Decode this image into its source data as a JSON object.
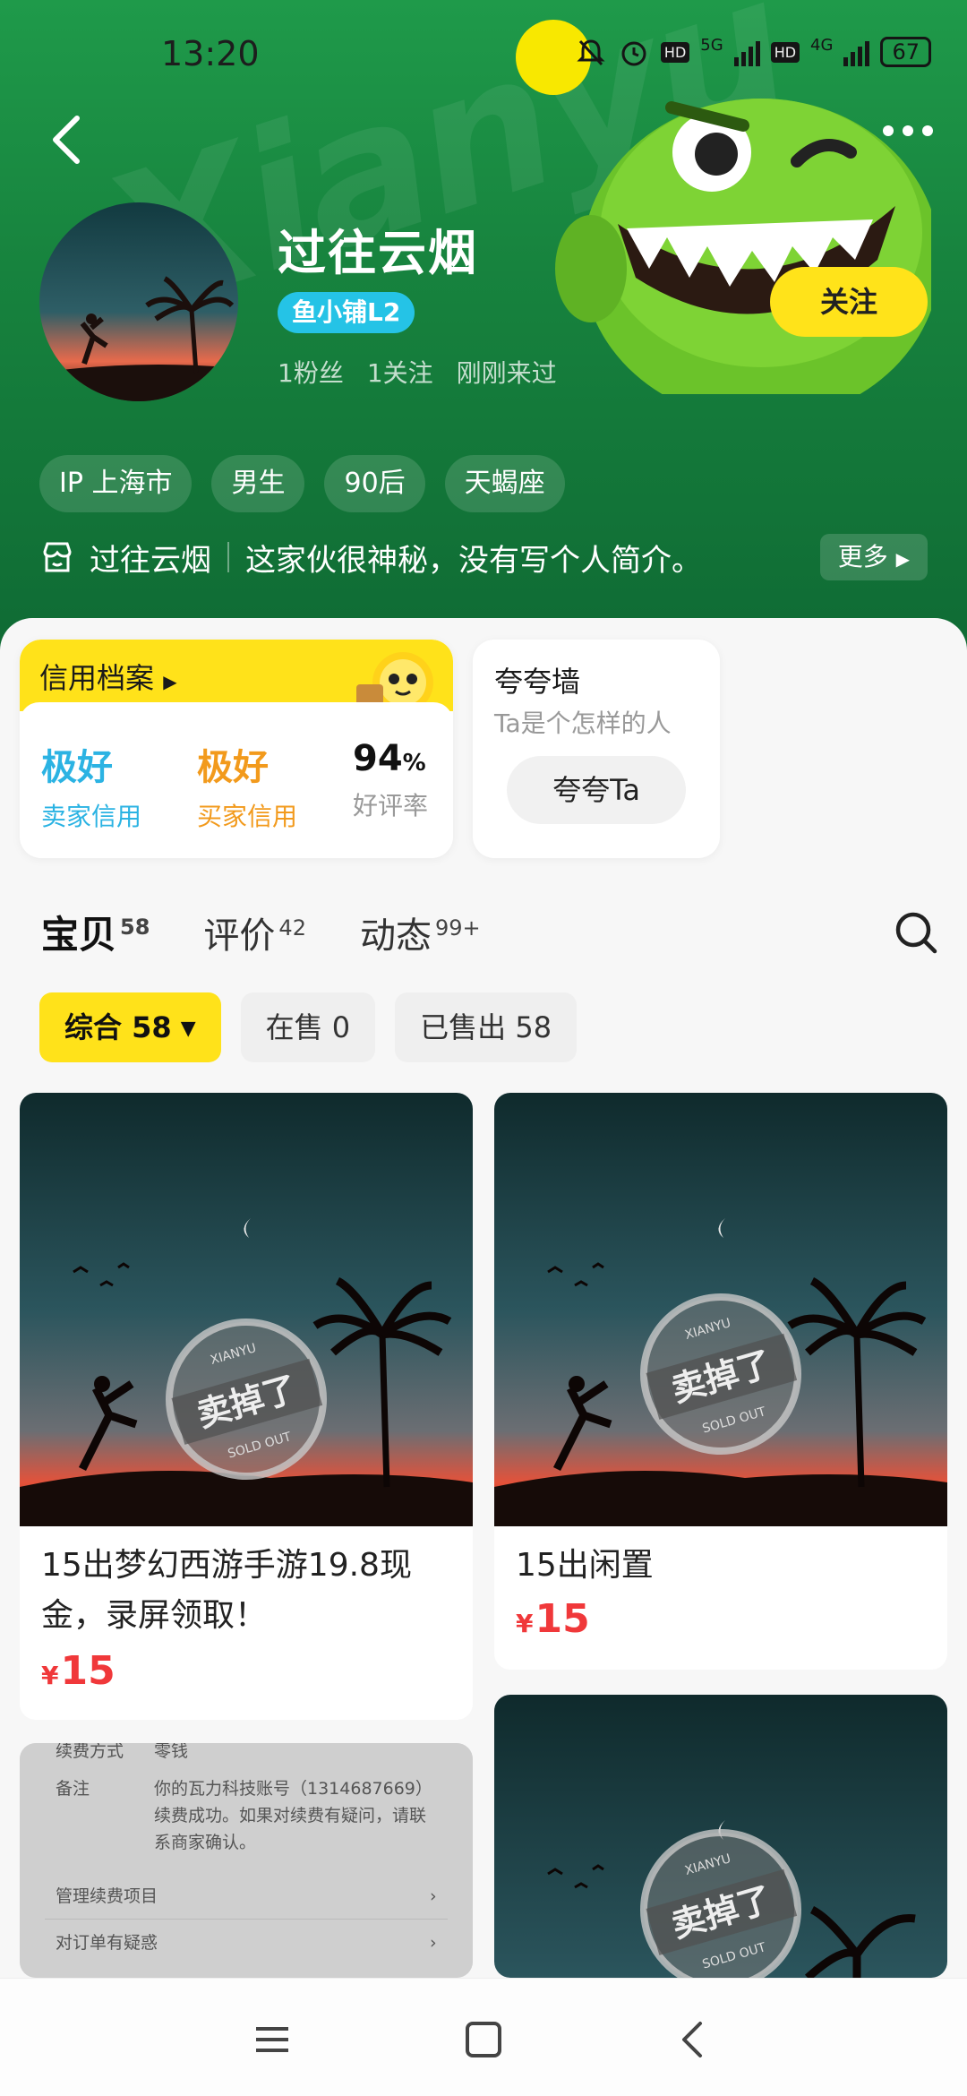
{
  "status_bar": {
    "time": "13:20",
    "network_5g": "5G",
    "network_4g": "4G",
    "hd": "HD",
    "battery": "67"
  },
  "header": {
    "watermark": "Xianyu",
    "back_icon": "back-arrow-icon",
    "more_icon": "more-dots-icon"
  },
  "profile": {
    "nickname": "过往云烟",
    "shop_badge": "鱼小铺L2",
    "stats": [
      "1粉丝",
      "1关注",
      "刚刚来过"
    ],
    "follow_label": "关注",
    "tags": [
      "IP 上海市",
      "男生",
      "90后",
      "天蝎座"
    ],
    "intro_name": "过往云烟",
    "intro_text": "这家伙很神秘，没有写个人简介。",
    "intro_more": "更多"
  },
  "credit": {
    "title": "信用档案",
    "seller_value": "极好",
    "seller_label": "卖家信用",
    "buyer_value": "极好",
    "buyer_label": "买家信用",
    "rate_value": "94",
    "rate_unit": "%",
    "rate_label": "好评率"
  },
  "praise": {
    "title": "夸夸墙",
    "subtitle": "Ta是个怎样的人",
    "button": "夸夸Ta"
  },
  "tabs": [
    {
      "label": "宝贝",
      "count": "58"
    },
    {
      "label": "评价",
      "count": "42"
    },
    {
      "label": "动态",
      "count": "99+"
    }
  ],
  "filters": [
    {
      "label": "综合 58"
    },
    {
      "label": "在售 0"
    },
    {
      "label": "已售出 58"
    }
  ],
  "products": [
    {
      "title": "15出梦幻西游手游19.8现金，录屏领取！",
      "currency": "¥",
      "price": "15",
      "stamp_text": "卖掉了",
      "stamp_sub": "SOLD OUT",
      "stamp_top": "XIANYU"
    },
    {
      "title": "15出闲置",
      "currency": "¥",
      "price": "15",
      "stamp_text": "卖掉了",
      "stamp_sub": "SOLD OUT",
      "stamp_top": "XIANYU"
    },
    {
      "receipt_lines": [
        "续费方式",
        "零钱",
        "备注",
        "你的瓦力科技账号（1314687669）续费成功。如果对续费有疑问，请联系商家确认。",
        "管理续费项目",
        "对订单有疑惑"
      ]
    },
    {
      "stamp_text": "卖掉了",
      "stamp_sub": "SOLD OUT",
      "stamp_top": "XIANYU"
    }
  ],
  "colors": {
    "header_green": "#1f9a4a",
    "accent_yellow": "#ffe21a",
    "price_red": "#f0383a",
    "seller_blue": "#2bb3e3",
    "buyer_orange": "#f29a1c"
  }
}
